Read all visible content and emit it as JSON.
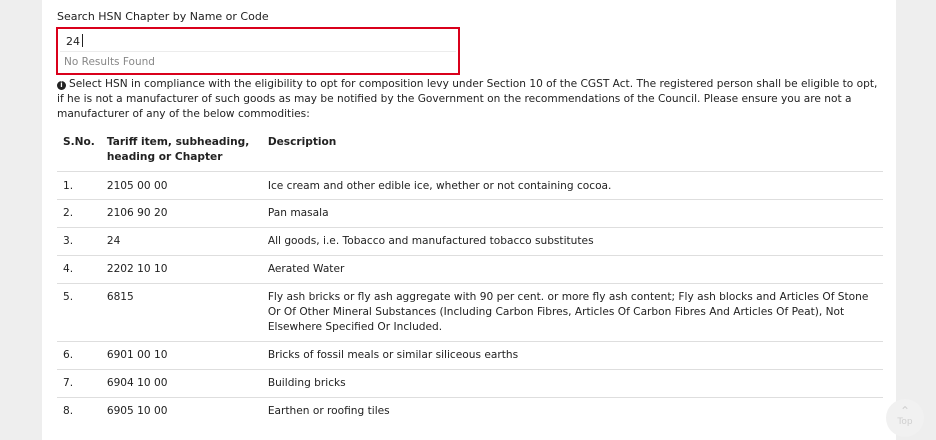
{
  "search": {
    "label": "Search HSN Chapter by Name or Code",
    "value": "24",
    "no_results": "No Results Found"
  },
  "info": {
    "icon": "info-circle-icon",
    "text": "Select HSN in compliance with the eligibility to opt for composition levy under Section 10 of the CGST Act. The registered person shall be eligible to opt, if he is not a manufacturer of such goods as may be notified by the Government on the recommendations of the Council. Please ensure you are not a manufacturer of any of the below commodities:"
  },
  "table": {
    "headers": {
      "sno": "S.No.",
      "tariff": "Tariff item, subheading, heading or Chapter",
      "description": "Description"
    },
    "rows": [
      {
        "sno": "1.",
        "tariff": "2105 00 00",
        "description": "Ice cream and other edible ice, whether or not containing cocoa."
      },
      {
        "sno": "2.",
        "tariff": "2106 90 20",
        "description": "Pan masala"
      },
      {
        "sno": "3.",
        "tariff": "24",
        "description": "All goods, i.e. Tobacco and manufactured tobacco substitutes"
      },
      {
        "sno": "4.",
        "tariff": "2202 10 10",
        "description": "Aerated Water"
      },
      {
        "sno": "5.",
        "tariff": "6815",
        "description": "Fly ash bricks or fly ash aggregate with 90 per cent. or more fly ash content; Fly ash blocks and Articles Of Stone Or Of Other Mineral Substances (Including Carbon Fibres, Articles Of Carbon Fibres And Articles Of Peat), Not Elsewhere Specified Or Included."
      },
      {
        "sno": "6.",
        "tariff": "6901 00 10",
        "description": "Bricks of fossil meals or similar siliceous earths"
      },
      {
        "sno": "7.",
        "tariff": "6904 10 00",
        "description": "Building bricks"
      },
      {
        "sno": "8.",
        "tariff": "6905 10 00",
        "description": "Earthen or roofing tiles"
      }
    ]
  },
  "scroll_top": {
    "icon": "chevron-up-icon",
    "label": "Top"
  },
  "colors": {
    "search_border": "#d9001b",
    "background": "#eeeeee",
    "panel": "#ffffff"
  }
}
